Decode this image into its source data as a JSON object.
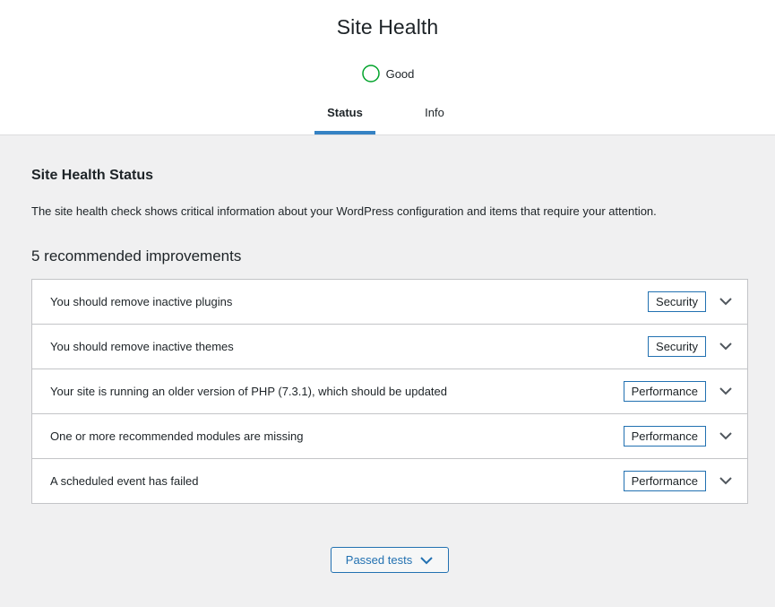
{
  "header": {
    "title": "Site Health",
    "status_label": "Good",
    "status_color": "#00a32a"
  },
  "tabs": [
    {
      "label": "Status",
      "active": true
    },
    {
      "label": "Info",
      "active": false
    }
  ],
  "main": {
    "section_title": "Site Health Status",
    "description": "The site health check shows critical information about your WordPress configuration and items that require your attention.",
    "improvements_title": "5 recommended improvements",
    "issues": [
      {
        "label": "You should remove inactive plugins",
        "badge": "Security"
      },
      {
        "label": "You should remove inactive themes",
        "badge": "Security"
      },
      {
        "label": "Your site is running an older version of PHP (7.3.1), which should be updated",
        "badge": "Performance"
      },
      {
        "label": "One or more recommended modules are missing",
        "badge": "Performance"
      },
      {
        "label": "A scheduled event has failed",
        "badge": "Performance"
      }
    ],
    "passed_tests_label": "Passed tests"
  },
  "icons": {
    "status_ring": "status-good-ring-icon",
    "issue_toggle": "chevron-down-icon",
    "passed_toggle": "chevron-down-icon"
  },
  "colors": {
    "accent": "#2271b1",
    "tab_active_border": "#3582c4",
    "good": "#00a32a"
  }
}
